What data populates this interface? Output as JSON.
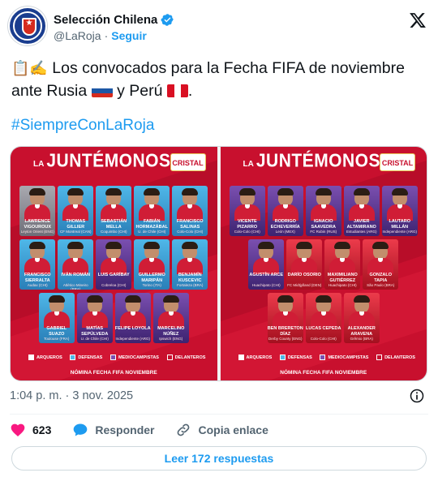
{
  "account": {
    "display_name": "Selección Chilena",
    "handle": "@LaRoja",
    "dot": "·",
    "follow_label": "Seguir",
    "avatar_icon": "federation-crest-icon",
    "verified_icon": "verified-badge-icon",
    "platform_icon": "x-logo-icon"
  },
  "tweet": {
    "line1": "Los convocados para la Fecha FIFA de noviembre",
    "line2_prefix": "ante Rusia",
    "line2_mid": "y Perú",
    "line2_suffix": ".",
    "hashtag": "#SiempreConLaRoja",
    "emojis": [
      "clipboard-icon",
      "writing-hand-icon",
      "russia-flag-icon",
      "peru-flag-icon"
    ]
  },
  "media": {
    "panels": [
      {
        "title_small": "LA",
        "title_big": "JUNTÉMONOS",
        "sponsor": "CRISTAL",
        "rows": [
          [
            {
              "name": "LAWRENCE VIGOUROUX",
              "club": "Leyton Orient (ENG)",
              "pos": "arq"
            },
            {
              "name": "THOMAS GILLIER",
              "club": "CF Montreal (CAN)",
              "pos": "def"
            },
            {
              "name": "SEBASTIÁN MELLA",
              "club": "Coquimbo (CHI)",
              "pos": "def"
            },
            {
              "name": "FABIÁN HORMAZÁBAL",
              "club": "U. de Chile (CHI)",
              "pos": "def"
            },
            {
              "name": "FRANCISCO SALINAS",
              "club": "Colo-Colo (CHI)",
              "pos": "def"
            }
          ],
          [
            {
              "name": "FRANCISCO SIERRALTA",
              "club": "Audax (CHI)",
              "pos": "def"
            },
            {
              "name": "IVÁN ROMÁN",
              "club": "Atlético Mineiro (BRA)",
              "pos": "def"
            },
            {
              "name": "LUIS GARÍBAY",
              "club": "Cobreloa (CHI)",
              "pos": "med"
            },
            {
              "name": "GUILLERMO MARIPÁN",
              "club": "Torino (ITA)",
              "pos": "def"
            },
            {
              "name": "BENJAMÍN KUSCEVIC",
              "club": "Fortaleza (BRA)",
              "pos": "def"
            }
          ],
          [
            {
              "name": "GABRIEL SUAZO",
              "club": "Toulouse (FRA)",
              "pos": "def"
            },
            {
              "name": "MATÍAS SEPÚLVEDA",
              "club": "U. de Chile (CHI)",
              "pos": "med"
            },
            {
              "name": "FELIPE LOYOLA",
              "club": "Independiente (ARG)",
              "pos": "med"
            },
            {
              "name": "MARCELINO NÚÑEZ",
              "club": "Ipswich (ENG)",
              "pos": "med"
            }
          ]
        ],
        "legend": [
          "ARQUEROS",
          "DEFENSAS",
          "MEDIOCAMPISTAS",
          "DELANTEROS"
        ],
        "footer": "NÓMINA FECHA FIFA NOVIEMBRE"
      },
      {
        "title_small": "LA",
        "title_big": "JUNTÉMONOS",
        "sponsor": "CRISTAL",
        "rows": [
          [
            {
              "name": "VICENTE PIZARRO",
              "club": "Colo-Colo (CHI)",
              "pos": "med"
            },
            {
              "name": "RODRIGO ECHEVERRÍA",
              "club": "León (MEX)",
              "pos": "med"
            },
            {
              "name": "IGNACIO SAAVEDRA",
              "club": "FC Rubin (RUS)",
              "pos": "med"
            },
            {
              "name": "JAVIER ALTAMIRANO",
              "club": "Estudiantes (ARG)",
              "pos": "med"
            },
            {
              "name": "LAUTARO MILLÁN",
              "club": "Independiente (ARG)",
              "pos": "med"
            }
          ],
          [
            {
              "name": "AGUSTÍN ARCE",
              "club": "Huachipato (CHI)",
              "pos": "med"
            },
            {
              "name": "DARÍO OSORIO",
              "club": "FC Midtjylland (DEN)",
              "pos": "del"
            },
            {
              "name": "MAXIMILIANO GUTIÉRREZ",
              "club": "Huachipato (CHI)",
              "pos": "del"
            },
            {
              "name": "GONZALO TAPIA",
              "club": "São Paulo (BRA)",
              "pos": "del"
            }
          ],
          [
            {
              "name": "BEN BRERETON DÍAZ",
              "club": "Derby County (ENG)",
              "pos": "del"
            },
            {
              "name": "LUCAS CEPEDA",
              "club": "Colo-Colo (CHI)",
              "pos": "del"
            },
            {
              "name": "ALEXANDER ARAVENA",
              "club": "Grêmio (BRA)",
              "pos": "del"
            }
          ]
        ],
        "legend": [
          "ARQUEROS",
          "DEFENSAS",
          "MEDIOCAMPISTAS",
          "DELANTEROS"
        ],
        "footer": "NÓMINA FECHA FIFA NOVIEMBRE"
      }
    ]
  },
  "meta": {
    "time": "1:04 p. m.",
    "dot": "·",
    "date": "3 nov. 2025"
  },
  "actions": {
    "like_count": "623",
    "reply_label": "Responder",
    "copy_label": "Copia enlace"
  },
  "replies_button": "Leer 172 respuestas",
  "colors": {
    "accent": "#1d9bf0",
    "panel_red": "#c8102e",
    "like_red": "#f91880",
    "text": "#0f1419",
    "muted": "#536471"
  }
}
